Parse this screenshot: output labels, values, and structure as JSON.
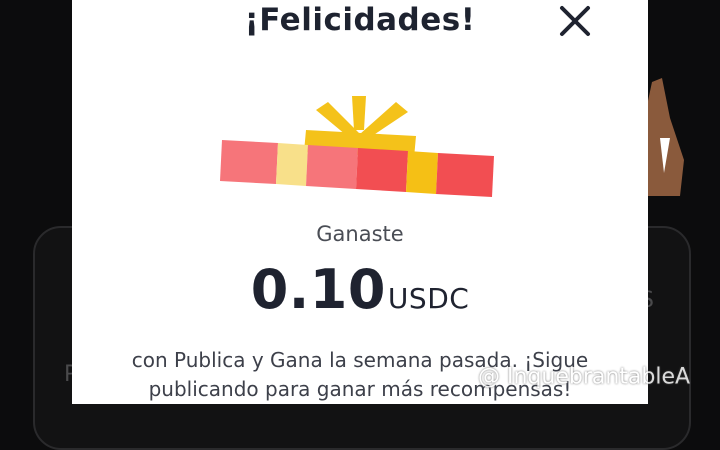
{
  "modal": {
    "title": "¡Felicidades!",
    "won_label": "Ganaste",
    "amount": "0.10",
    "unit": "USDC",
    "message": "con Publica y Gana la semana pasada. ¡Sigue publicando para ganar más recompensas!"
  },
  "icons": {
    "close": "close-icon",
    "gift": "gift-icon"
  },
  "backdrop": {
    "left_fragment": "P",
    "right_fragment": "S"
  },
  "watermark": {
    "handle": "@ InquebrantableA"
  },
  "colors": {
    "ribbon_red": "#f24e52",
    "ribbon_pink": "#f6757a",
    "ribbon_yellow": "#f5c015",
    "bow_yellow": "#f4c21a",
    "text_dark": "#1f2330"
  }
}
